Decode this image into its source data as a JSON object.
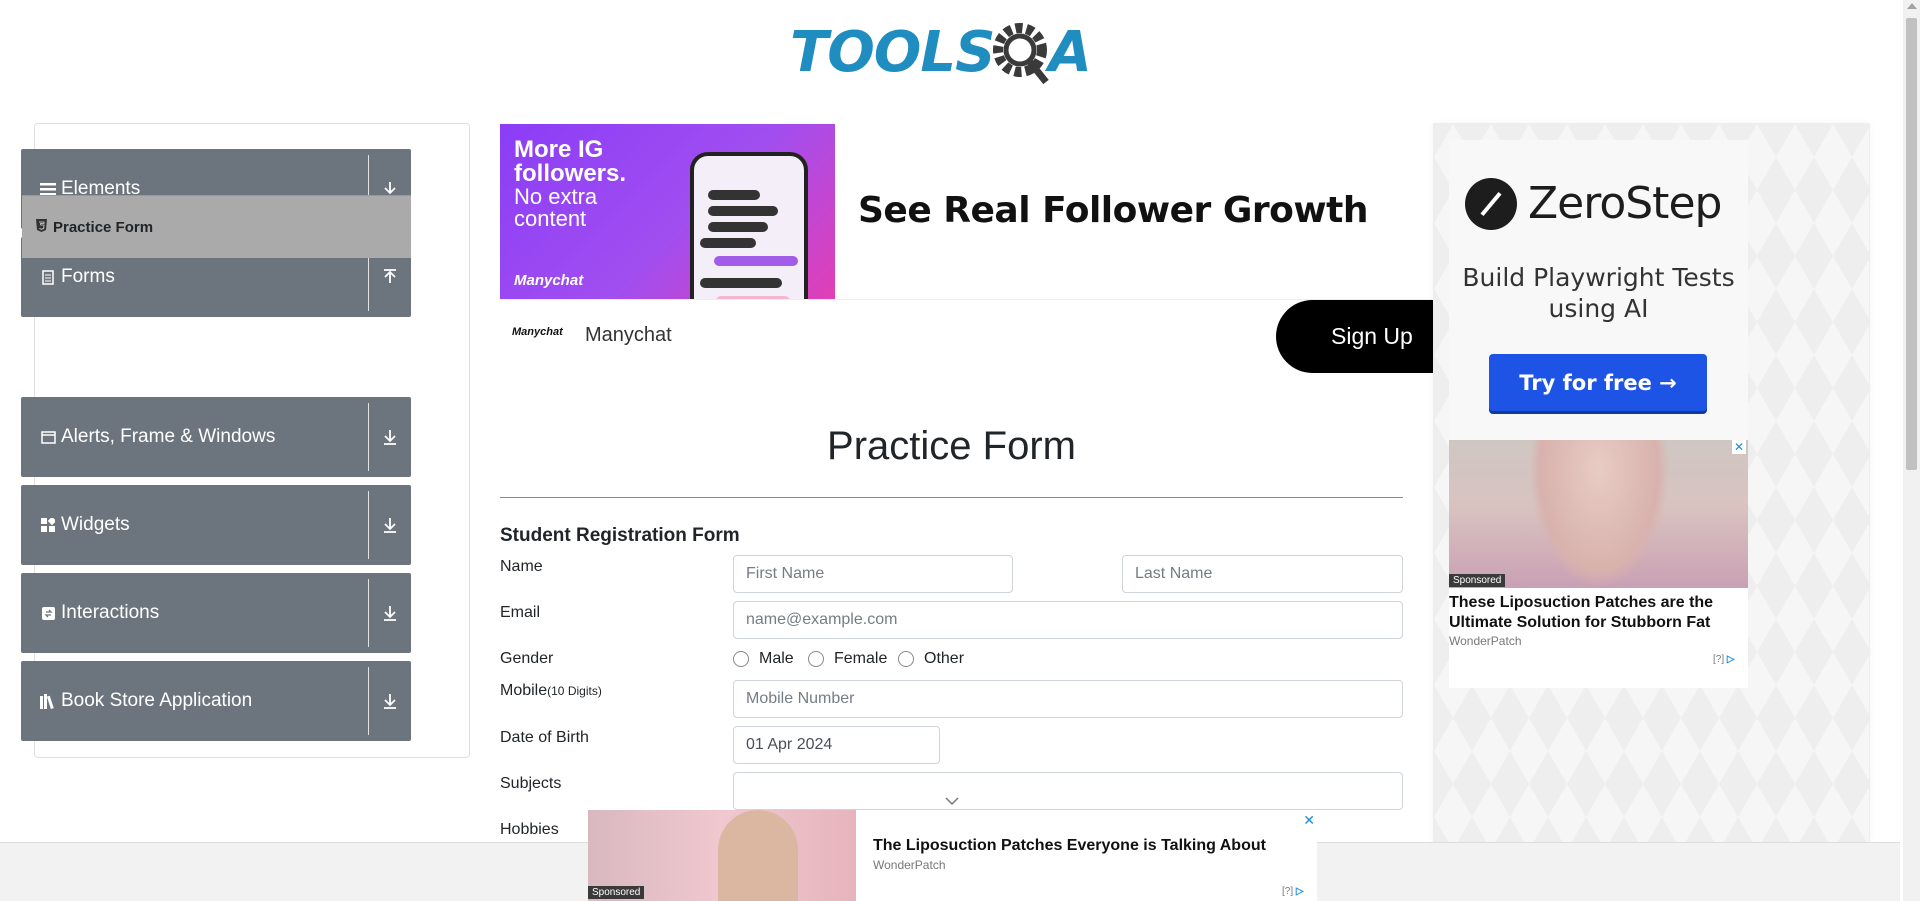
{
  "header": {
    "logo_part1": "TOOLS",
    "logo_part2": "A"
  },
  "sidebar": {
    "groups": [
      {
        "label": "Elements",
        "icon": "menu-icon",
        "arrow": "download-arrow"
      },
      {
        "label": "Forms",
        "icon": "document-icon",
        "arrow": "upload-arrow"
      },
      {
        "label": "Alerts, Frame & Windows",
        "icon": "window-icon",
        "arrow": "download-arrow"
      },
      {
        "label": "Widgets",
        "icon": "widgets-icon",
        "arrow": "download-arrow"
      },
      {
        "label": "Interactions",
        "icon": "interactions-icon",
        "arrow": "download-arrow"
      },
      {
        "label": "Book Store Application",
        "icon": "books-icon",
        "arrow": "download-arrow"
      }
    ],
    "active_item": "Practice Form"
  },
  "top_ad": {
    "image_line1": "More IG",
    "image_line2": "followers.",
    "image_line3": "No extra",
    "image_line4": "content",
    "image_brand": "Manychat",
    "headline": "See Real Follower Growth",
    "brand_logo": "Manychat",
    "brand_name": "Manychat",
    "cta": "Sign Up"
  },
  "form": {
    "title": "Practice Form",
    "subtitle": "Student Registration Form",
    "name_label": "Name",
    "first_name_placeholder": "First Name",
    "last_name_placeholder": "Last Name",
    "email_label": "Email",
    "email_placeholder": "name@example.com",
    "gender_label": "Gender",
    "gender_options": [
      "Male",
      "Female",
      "Other"
    ],
    "mobile_label": "Mobile",
    "mobile_hint": "(10 Digits)",
    "mobile_placeholder": "Mobile Number",
    "dob_label": "Date of Birth",
    "dob_value": "01 Apr 2024",
    "subjects_label": "Subjects",
    "hobbies_label": "Hobbies"
  },
  "right_ad": {
    "brand": "ZeroStep",
    "tagline": "Build Playwright Tests using AI",
    "cta": "Try for free →",
    "sponsored": "Sponsored",
    "ad_title": "These Liposuction Patches are the Ultimate Solution for Stubborn Fat",
    "ad_source": "WonderPatch",
    "ad_info": "[?]"
  },
  "bottom_ad": {
    "sponsored": "Sponsored",
    "title": "The Liposuction Patches Everyone is Talking About",
    "source": "WonderPatch",
    "info": "[?]",
    "close": "✕"
  }
}
